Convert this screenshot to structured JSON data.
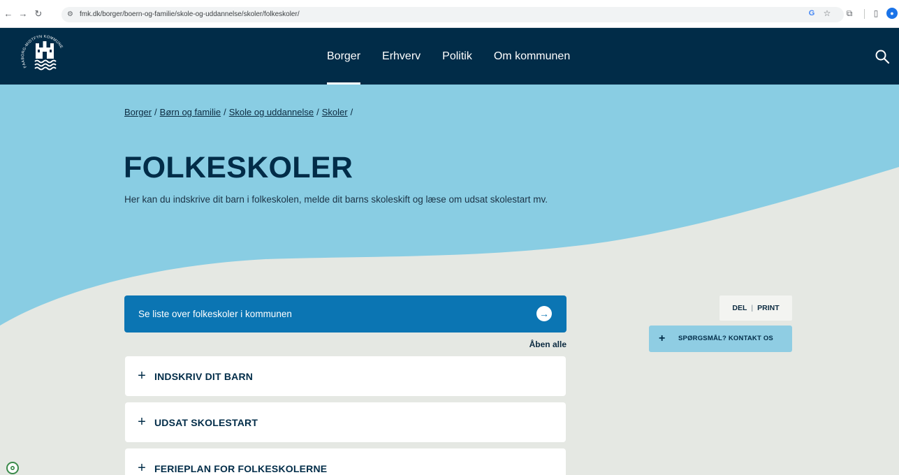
{
  "browser": {
    "url": "fmk.dk/borger/boern-og-familie/skole-og-uddannelse/skoler/folkeskoler/",
    "back_icon": "arrow-left-icon",
    "forward_icon": "arrow-right-icon",
    "reload_icon": "reload-icon"
  },
  "header": {
    "logo_text": "FAABORG-MIDTFYN KOMMUNE",
    "nav": [
      {
        "label": "Borger",
        "active": true
      },
      {
        "label": "Erhverv",
        "active": false
      },
      {
        "label": "Politik",
        "active": false
      },
      {
        "label": "Om kommunen",
        "active": false
      }
    ],
    "search_icon": "search-icon"
  },
  "breadcrumb": [
    "Borger",
    "Børn og familie",
    "Skole og uddannelse",
    "Skoler"
  ],
  "page": {
    "title": "FOLKESKOLER",
    "intro": "Her kan du indskrive dit barn i folkeskolen, melde dit barns skoleskift og læse om udsat skolestart mv."
  },
  "list_link": {
    "label": "Se liste over folkeskoler i kommunen"
  },
  "open_all": "Åben alle",
  "accordion": [
    {
      "title": "INDSKRIV DIT BARN"
    },
    {
      "title": "UDSAT SKOLESTART"
    },
    {
      "title": "FERIEPLAN FOR FOLKESKOLERNE"
    }
  ],
  "share": {
    "del": "DEL",
    "print": "PRINT"
  },
  "contact": {
    "label": "SPØRGSMÅL? KONTAKT OS"
  },
  "colors": {
    "header_bg": "#012c48",
    "hero_blue": "#89cde3",
    "page_bg": "#e5e8e3",
    "link_blue": "#0b75b3"
  }
}
